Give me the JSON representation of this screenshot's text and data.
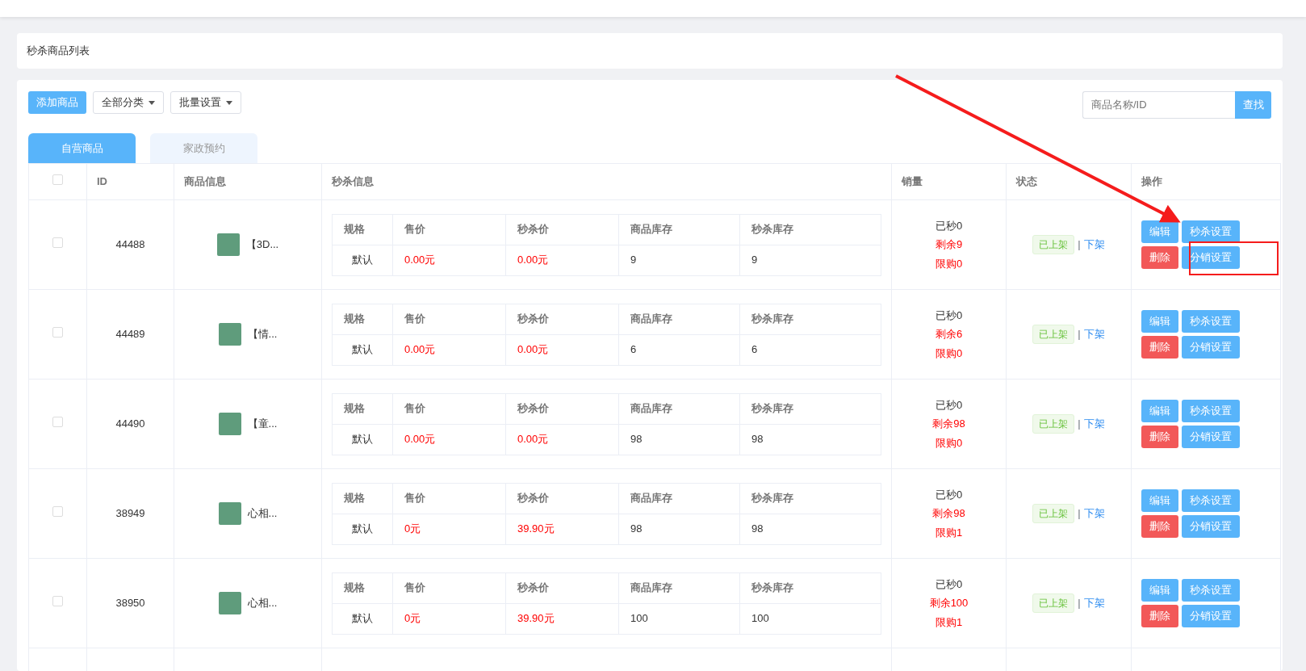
{
  "page_title": "秒杀商品列表",
  "toolbar": {
    "add_button": "添加商品",
    "category_dropdown": "全部分类",
    "batch_dropdown": "批量设置",
    "search": {
      "placeholder": "商品名称/ID"
    },
    "search_button": "查找"
  },
  "tabs": [
    {
      "label": "自营商品",
      "selected": true
    },
    {
      "label": "家政预约",
      "selected": false
    }
  ],
  "table": {
    "select_all_checked": false,
    "columns": [
      "ID",
      "商品信息",
      "秒杀信息",
      "销量",
      "状态",
      "操作"
    ],
    "rows": [
      {
        "checked": false,
        "id": "44488",
        "product": "【3D...",
        "spec_columns": [
          "规格",
          "售价",
          "秒杀价",
          "商品库存",
          "秒杀库存"
        ],
        "spec_cells": [
          "默认",
          "0.00元",
          "0.00元",
          "9",
          "9"
        ],
        "sold": "已秒0",
        "remaining": "剩余9",
        "limit": "限购0",
        "status": "已上架",
        "separator": "|",
        "off_link": "下架",
        "actions": [
          {
            "label": "编辑",
            "kind": "primary"
          },
          {
            "label": "秒杀设置",
            "kind": "primary"
          },
          {
            "label": "删除",
            "kind": "danger"
          },
          {
            "label": "分销设置",
            "kind": "primary"
          }
        ]
      },
      {
        "checked": false,
        "id": "44489",
        "product": "【情...",
        "spec_columns": [
          "规格",
          "售价",
          "秒杀价",
          "商品库存",
          "秒杀库存"
        ],
        "spec_cells": [
          "默认",
          "0.00元",
          "0.00元",
          "6",
          "6"
        ],
        "sold": "已秒0",
        "remaining": "剩余6",
        "limit": "限购0",
        "status": "已上架",
        "separator": "|",
        "off_link": "下架",
        "actions": [
          {
            "label": "编辑",
            "kind": "primary"
          },
          {
            "label": "秒杀设置",
            "kind": "primary"
          },
          {
            "label": "删除",
            "kind": "danger"
          },
          {
            "label": "分销设置",
            "kind": "primary"
          }
        ]
      },
      {
        "checked": false,
        "id": "44490",
        "product": "【童...",
        "spec_columns": [
          "规格",
          "售价",
          "秒杀价",
          "商品库存",
          "秒杀库存"
        ],
        "spec_cells": [
          "默认",
          "0.00元",
          "0.00元",
          "98",
          "98"
        ],
        "sold": "已秒0",
        "remaining": "剩余98",
        "limit": "限购0",
        "status": "已上架",
        "separator": "|",
        "off_link": "下架",
        "actions": [
          {
            "label": "编辑",
            "kind": "primary"
          },
          {
            "label": "秒杀设置",
            "kind": "primary"
          },
          {
            "label": "删除",
            "kind": "danger"
          },
          {
            "label": "分销设置",
            "kind": "primary"
          }
        ]
      },
      {
        "checked": false,
        "id": "38949",
        "product": "心相...",
        "spec_columns": [
          "规格",
          "售价",
          "秒杀价",
          "商品库存",
          "秒杀库存"
        ],
        "spec_cells": [
          "默认",
          "0元",
          "39.90元",
          "98",
          "98"
        ],
        "sold": "已秒0",
        "remaining": "剩余98",
        "limit": "限购1",
        "status": "已上架",
        "separator": "|",
        "off_link": "下架",
        "actions": [
          {
            "label": "编辑",
            "kind": "primary"
          },
          {
            "label": "秒杀设置",
            "kind": "primary"
          },
          {
            "label": "删除",
            "kind": "danger"
          },
          {
            "label": "分销设置",
            "kind": "primary"
          }
        ]
      },
      {
        "checked": false,
        "id": "38950",
        "product": "心相...",
        "spec_columns": [
          "规格",
          "售价",
          "秒杀价",
          "商品库存",
          "秒杀库存"
        ],
        "spec_cells": [
          "默认",
          "0元",
          "39.90元",
          "100",
          "100"
        ],
        "sold": "已秒0",
        "remaining": "剩余100",
        "limit": "限购1",
        "status": "已上架",
        "separator": "|",
        "off_link": "下架",
        "actions": [
          {
            "label": "编辑",
            "kind": "primary"
          },
          {
            "label": "秒杀设置",
            "kind": "primary"
          },
          {
            "label": "删除",
            "kind": "danger"
          },
          {
            "label": "分销设置",
            "kind": "primary"
          }
        ]
      }
    ]
  }
}
